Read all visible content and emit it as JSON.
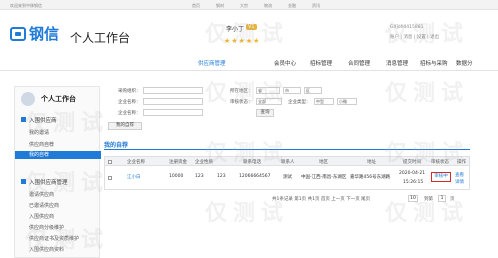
{
  "topbar": {
    "welcome": "欢迎来到中移钢信",
    "links": [
      "首页",
      "钢材",
      "大宗",
      "物流",
      "金融",
      "资讯"
    ]
  },
  "header": {
    "logo_text": "钢信",
    "title": "个人工作台",
    "user_name": "李小丁",
    "user_level": "V1",
    "stars": "★★★★★",
    "account": "GXjoh4415881",
    "account2": "账户 | 消息 | 设置 | 退出"
  },
  "nav": {
    "items": [
      "供应商管理",
      "会员中心",
      "招标管理",
      "合同管理",
      "消息管理",
      "招标与采购",
      "数据分"
    ]
  },
  "sidebar": {
    "title": "个人工作台",
    "section1": "入围供应商",
    "section1_items": [
      "我的邀请",
      "供应商自荐",
      "我的自荐"
    ],
    "section2": "入围供应商管理",
    "section2_items": [
      "邀请供应商",
      "已邀请供应商",
      "入围供应商",
      "供应商分级维护",
      "供应商证书及资质维护",
      "入围供应商资料"
    ]
  },
  "form": {
    "purchaser_label": "采购组织：",
    "company_label": "企业名称：",
    "enterprise_label": "企业名称：",
    "region_label": "所在地区：",
    "region_value": "省",
    "city_value": "市",
    "district_value": "区",
    "status_label": "审核状态：",
    "status_value": "全部",
    "type_label": "企业类型：",
    "type_value": "中型",
    "size_value": "小微",
    "query_button": "查询",
    "my_recommend_button": "我的自荐"
  },
  "section": {
    "title": "我的自荐"
  },
  "table": {
    "headers": [
      "企业名称",
      "注册资金",
      "企业性质",
      "联系电话",
      "联系人",
      "地区",
      "地址",
      "提交时间",
      "审核状态",
      "操作"
    ],
    "rows": [
      {
        "name": "江小白",
        "capital": "10000",
        "nature": "123",
        "qty": "123",
        "phone": "12066664567",
        "contact": "测试",
        "region": "中国-江西-南昌-东湖区",
        "address": "嘉华路456号东湖路",
        "date": "2020-04-21",
        "time": "15:26:15",
        "status": "审核中",
        "op1": "查看",
        "op2": "详情"
      }
    ]
  },
  "pager": {
    "text": "共1条记录 第1页 共1页 首页 上一页 下一页 尾页",
    "per_page": "10",
    "jump_label": "到第",
    "page_num": "1",
    "page_unit": "页"
  },
  "watermark": "仅测试"
}
